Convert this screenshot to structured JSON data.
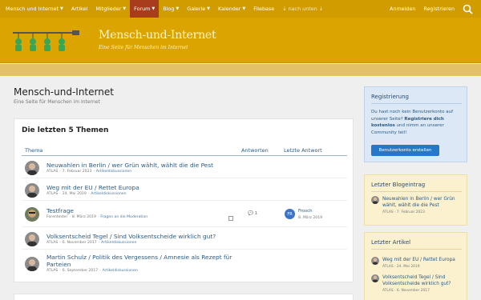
{
  "nav": {
    "items": [
      {
        "label": "Mensch und Internet",
        "caret": true
      },
      {
        "label": "Artikel",
        "caret": false
      },
      {
        "label": "Mitglieder",
        "caret": true
      },
      {
        "label": "Forum",
        "caret": true,
        "active": true
      },
      {
        "label": "Blog",
        "caret": true
      },
      {
        "label": "Galerie",
        "caret": true
      },
      {
        "label": "Kalender",
        "caret": true
      },
      {
        "label": "Filebase",
        "caret": false
      },
      {
        "label": "↓ nach unten ↓",
        "caret": false
      }
    ],
    "login": "Anmelden",
    "register": "Registrieren"
  },
  "banner": {
    "site_name": "Mensch-und-Internet",
    "tagline": "Eine Seite für Menschen im Internet"
  },
  "page": {
    "title": "Mensch-und-Internet",
    "subtitle": "Eine Seite für Menschen im Internet"
  },
  "topics": {
    "heading": "Die letzten 5 Themen",
    "col_topic": "Thema",
    "col_replies": "Antworten",
    "col_last": "Letzte Antwort",
    "rows": [
      {
        "title": "Neuwahlen in Berlin / wer Grün wählt, wählt die die Pest",
        "author": "ATLAS",
        "date": "7. Februar 2023",
        "forum": "Artikeldiskussionen"
      },
      {
        "title": "Weg mit der EU / Rettet Europa",
        "author": "ATLAS",
        "date": "24. Mai 2019",
        "forum": "Artikeldiskussionen"
      },
      {
        "title": "Testfrage",
        "author": "Forentester",
        "date": "8. März 2019",
        "forum": "Fragen an die Moderation",
        "replies": "1",
        "last_user": "Frosch",
        "last_initials": "FR",
        "last_date": "8. März 2019"
      },
      {
        "title": "Volksentscheid Tegel / Sind Volksentscheide wirklich gut?",
        "author": "ATLAS",
        "date": "6. November 2017",
        "forum": "Artikeldiskussionen"
      },
      {
        "title": "Martin Schulz / Politik des Vergessens / Amnesie als Rezept für Parteien",
        "author": "ATLAS",
        "date": "6. September 2017",
        "forum": "Artikeldiskussionen"
      }
    ]
  },
  "sidebar": {
    "register": {
      "title": "Registrierung",
      "text_pre": "Du hast noch kein Benutzerkonto auf unserer Seite? ",
      "text_bold": "Registriere dich kostenlos",
      "text_post": " und nimm an unserer Community teil!",
      "button": "Benutzerkonto erstellen"
    },
    "blog": {
      "title": "Letzter Blogeintrag",
      "entry_title": "Neuwahlen in Berlin / wer Grün wählt, wählt die die Pest",
      "author": "ATLAS",
      "date": "7. Februar 2023"
    },
    "articles": {
      "title": "Letzter Artikel",
      "items": [
        {
          "title": "Weg mit der EU / Rettet Europa",
          "author": "ATLAS",
          "date": "24. Mai 2019"
        },
        {
          "title": "Volksentscheid Tegel / Sind Volksentscheide wirklich gut?",
          "author": "ATLAS",
          "date": "6. November 2017"
        }
      ]
    }
  },
  "colors": {
    "nav": "#d19c00",
    "nav_active": "#a73d1c",
    "banner": "#dba400",
    "link": "#2b5a85",
    "button": "#2577c8"
  }
}
